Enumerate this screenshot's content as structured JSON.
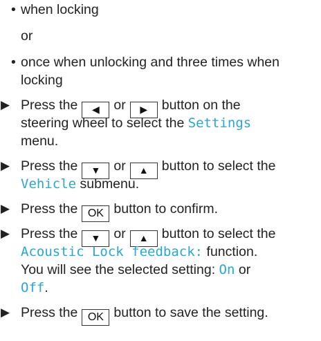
{
  "bullets": {
    "when_locking": "when locking",
    "or": "or",
    "once_unlocking_1": "once when unlocking and three times when",
    "once_unlocking_2": "locking",
    "bullet_char": "•"
  },
  "steps": {
    "marker": "▶",
    "s1_a": "Press the",
    "s1_b": "or",
    "s1_c": "button on the",
    "s1_d": "steering wheel to select the",
    "s1_e": "Settings",
    "s1_f": "menu.",
    "s2_a": "Press the",
    "s2_b": "or",
    "s2_c": "button to select the",
    "s2_d": "Vehicle",
    "s2_e": "submenu.",
    "s3_a": "Press the",
    "s3_b": "button to confirm.",
    "s4_a": "Press the",
    "s4_b": "or",
    "s4_c": "button to select the",
    "s4_d": "Acoustic Lock feedback:",
    "s4_e": "function.",
    "s4_f": "You will see the selected setting:",
    "s4_g": "On",
    "s4_h": "or",
    "s4_i": "Off",
    "s4_j": ".",
    "s5_a": "Press the",
    "s5_b": "button to save the setting."
  },
  "keys": {
    "left": "◀",
    "right": "▶",
    "down": "▼",
    "up": "▲",
    "ok": "OK"
  },
  "colors": {
    "text": "#222222",
    "highlight": "#2aa6d4"
  }
}
